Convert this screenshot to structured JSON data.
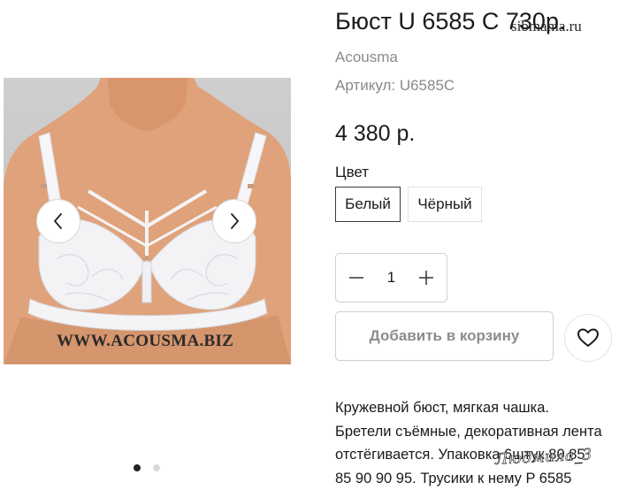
{
  "product": {
    "title": "Бюст U 6585 C 730р.",
    "brand": "Acousma",
    "sku": "Артикул: U6585C",
    "price": "4 380 р."
  },
  "gallery": {
    "watermark_text": "WWW.ACOUSMA.BIZ",
    "prev_icon": "chevron-left-icon",
    "next_icon": "chevron-right-icon",
    "dots": {
      "count": 2,
      "active_index": 0
    }
  },
  "colors": {
    "label": "Цвет",
    "options": [
      {
        "label": "Белый",
        "selected": true
      },
      {
        "label": "Чёрный",
        "selected": false
      }
    ]
  },
  "quantity": {
    "value": "1",
    "minus_icon": "minus-icon",
    "plus_icon": "plus-icon"
  },
  "cart": {
    "add_label": "Добавить в корзину",
    "wishlist_icon": "heart-icon"
  },
  "description": {
    "lines": [
      "Кружевной бюст, мягкая чашка.",
      "Бретели съёмные, декоративная лента",
      "отстёгивается. Упаковка 6штук 80 85",
      "85 90 90 95. Трусики к нему P 6585"
    ]
  },
  "overlays": {
    "site_watermark": "sibmama.ru",
    "user_signature": "Людмила_3"
  },
  "theme": {
    "text": "#1a1a1a",
    "muted": "#8a8a8a",
    "border": "#cfcfcf",
    "selected_border": "#3a3a3a",
    "image_bg": "#c8c8c8"
  }
}
